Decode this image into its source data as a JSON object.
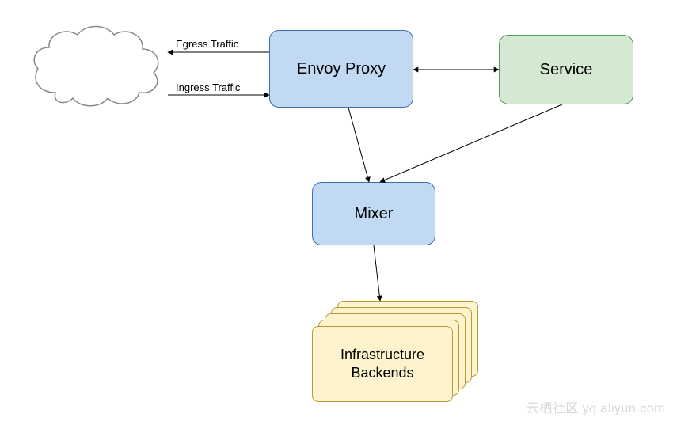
{
  "nodes": {
    "cloud_label": "",
    "envoy": "Envoy Proxy",
    "service": "Service",
    "mixer": "Mixer",
    "infra_line1": "Infrastructure",
    "infra_line2": "Backends"
  },
  "edges": {
    "egress": "Egress Traffic",
    "ingress": "Ingress Traffic"
  },
  "watermark": "云栖社区 yq.aliyun.com",
  "colors": {
    "blue_fill": "#c1d9f2",
    "blue_stroke": "#3a6fb0",
    "green_fill": "#d4e8d2",
    "green_stroke": "#4f9a57",
    "yellow_fill": "#fdf3cc",
    "yellow_stroke": "#b59a38",
    "cloud_stroke": "#888888"
  }
}
